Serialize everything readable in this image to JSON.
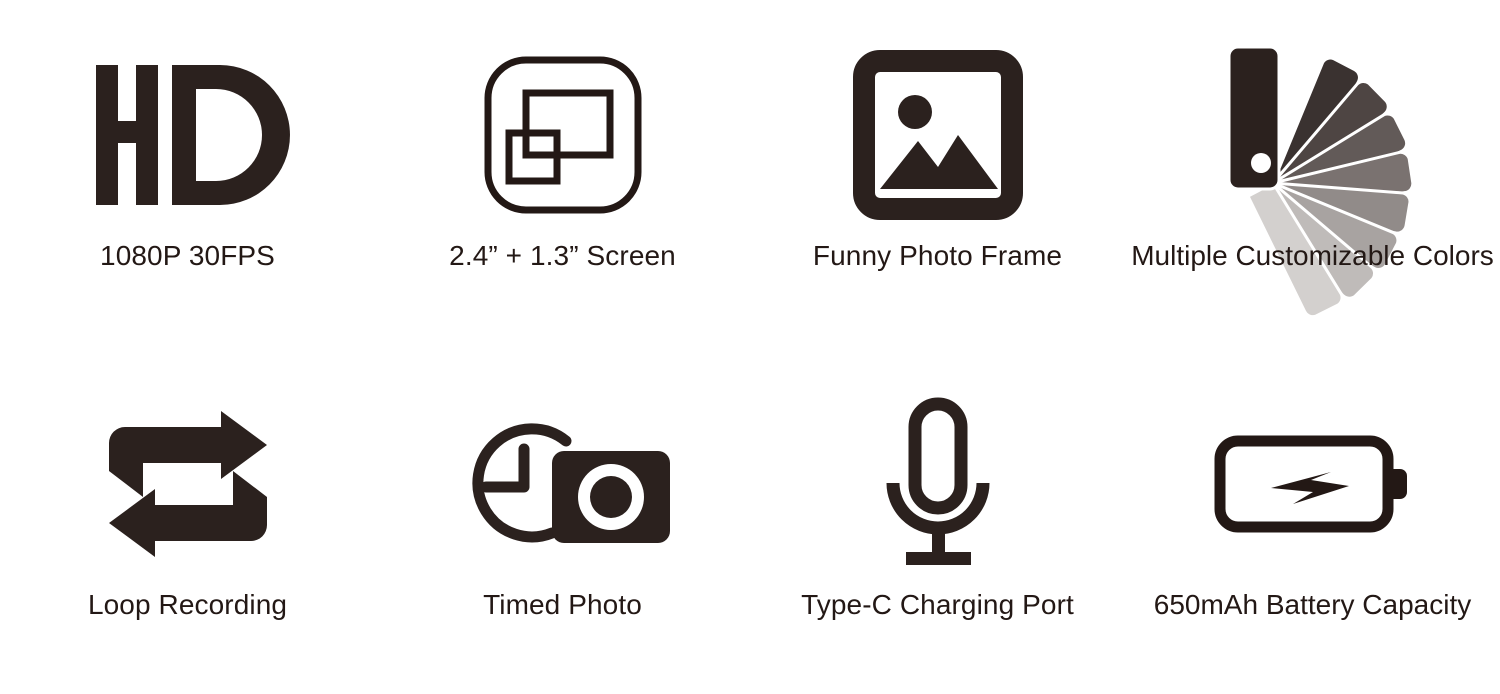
{
  "page": {
    "background": "#ffffff",
    "ink": "#231815",
    "icon_dark": "#2b211e",
    "layout": "4-column x 2-row feature icon grid"
  },
  "features": [
    {
      "id": "hd-video",
      "icon": "hd-icon",
      "icon_text": "HD",
      "label": "1080P 30FPS"
    },
    {
      "id": "dual-screen",
      "icon": "dual-screen-icon",
      "label": "2.4” + 1.3” Screen"
    },
    {
      "id": "photo-frame",
      "icon": "photo-frame-icon",
      "label": "Funny Photo Frame"
    },
    {
      "id": "custom-colors",
      "icon": "color-fan-icon",
      "label": "Multiple Customizable Colors"
    },
    {
      "id": "loop-recording",
      "icon": "loop-arrows-icon",
      "label": "Loop Recording"
    },
    {
      "id": "timed-photo",
      "icon": "clock-camera-icon",
      "label": "Timed Photo"
    },
    {
      "id": "type-c-port",
      "icon": "microphone-icon",
      "label": "Type-C Charging Port"
    },
    {
      "id": "battery",
      "icon": "battery-bolt-icon",
      "label": "650mAh Battery Capacity"
    }
  ],
  "color_fan": {
    "card_color": "#2b211e",
    "blade_colors": [
      "#3a3230",
      "#4e4543",
      "#625a58",
      "#7a7270",
      "#918b89",
      "#a8a3a1",
      "#bfbbb9",
      "#d3d0ce"
    ]
  }
}
